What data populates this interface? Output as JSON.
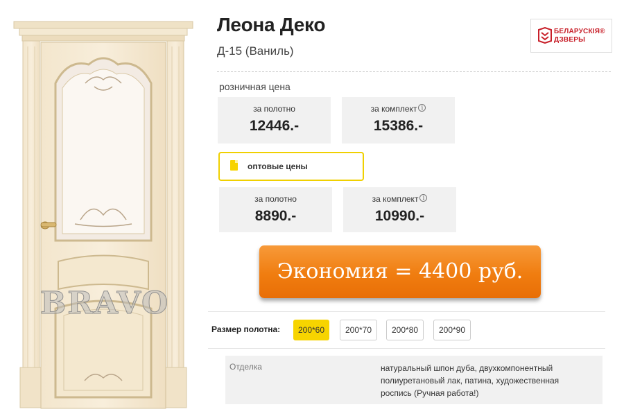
{
  "product": {
    "title": "Леона Деко",
    "subtitle": "Д-15 (Ваниль)"
  },
  "brand": {
    "line1": "БЕЛАРУСКІЯ®",
    "line2": "ДЗВЕРЫ",
    "color": "#c8202a"
  },
  "image": {
    "watermark": "BRAVO"
  },
  "retail": {
    "label": "розничная цена",
    "per_leaf_label": "за полотно",
    "per_leaf_value": "12446.-",
    "per_set_label": "за комплект",
    "per_set_value": "15386.-"
  },
  "wholesale": {
    "label": "оптовые цены",
    "per_leaf_label": "за полотно",
    "per_leaf_value": "8890.-",
    "per_set_label": "за комплект",
    "per_set_value": "10990.-"
  },
  "info_glyph": "i",
  "savings": {
    "text": "Экономия = 4400 руб.",
    "color": "#f07d10"
  },
  "sizes": {
    "label": "Размер полотна:",
    "options": [
      "200*60",
      "200*70",
      "200*80",
      "200*90"
    ],
    "selected": "200*60",
    "accent": "#f7d400"
  },
  "spec": {
    "key": "Отделка",
    "value": "натуральный шпон дуба, двухкомпонентный полиуретановый лак, патина, художественная роспись (Ручная работа!)"
  }
}
